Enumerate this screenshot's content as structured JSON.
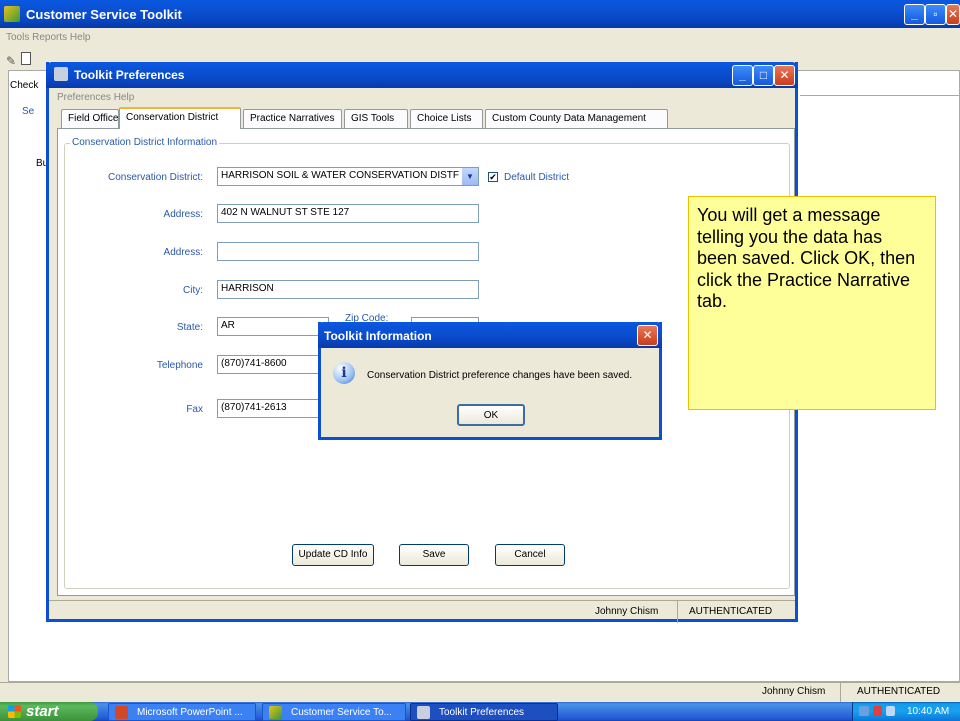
{
  "main_window": {
    "title": "Customer Service Toolkit",
    "menu": "Tools   Reports   Help",
    "status_user": "Johnny Chism",
    "status_auth": "AUTHENTICATED",
    "partial_tab": "Check",
    "partial_group": "Se",
    "partial_text": "Bu"
  },
  "dialog": {
    "title": "Toolkit Preferences",
    "menu": "Preferences   Help",
    "tabs": [
      "Field Office",
      "Conservation District",
      "Practice Narratives",
      "GIS Tools",
      "Choice Lists",
      "Custom County Data Management"
    ],
    "group_title": "Conservation District Information",
    "labels": {
      "district": "Conservation District:",
      "address1": "Address:",
      "address2": "Address:",
      "city": "City:",
      "state": "State:",
      "zip": "Zip Code:",
      "telephone": "Telephone",
      "fax": "Fax"
    },
    "values": {
      "district": "HARRISON SOIL & WATER CONSERVATION DISTF",
      "address1": "402 N WALNUT ST STE 127",
      "address2": "",
      "city": "HARRISON",
      "state": "AR",
      "telephone": "(870)741-8600",
      "fax": "(870)741-2613"
    },
    "default_district": "Default District",
    "buttons": {
      "update": "Update CD Info",
      "save": "Save",
      "cancel": "Cancel"
    },
    "status_user": "Johnny Chism",
    "status_auth": "AUTHENTICATED"
  },
  "message_box": {
    "title": "Toolkit Information",
    "message": "Conservation District preference changes have been saved.",
    "ok": "OK"
  },
  "callout": {
    "text": "You will get a message telling you the data has been saved. Click OK, then click the Practice Narrative tab."
  },
  "taskbar": {
    "start": "start",
    "items": [
      "Microsoft PowerPoint ...",
      "Customer Service To...",
      "Toolkit Preferences"
    ],
    "clock": "10:40 AM"
  },
  "colors": {
    "xp_blue": "#0a58e0",
    "callout_bg": "#ffff99",
    "callout_border": "#f0c000"
  }
}
